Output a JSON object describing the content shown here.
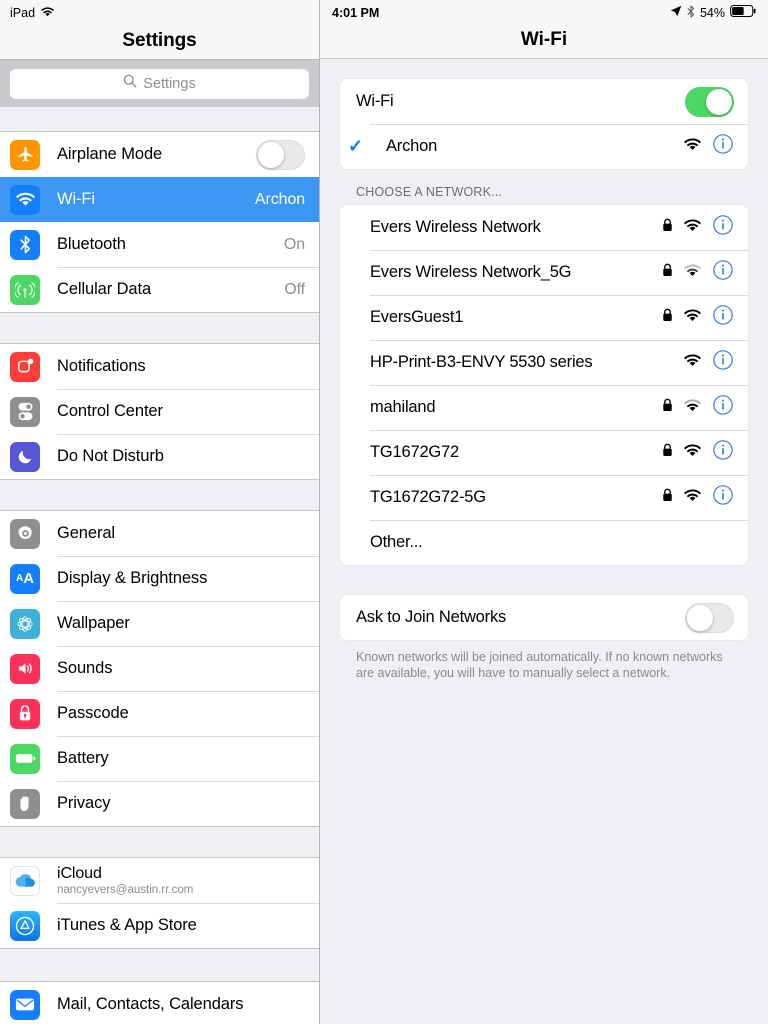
{
  "sidebar": {
    "status": {
      "device": "iPad",
      "wifi_icon": "wifi-icon"
    },
    "title": "Settings",
    "search": {
      "placeholder": "Settings",
      "icon": "search-icon"
    },
    "groups": [
      {
        "items": [
          {
            "label": "Airplane Mode",
            "icon": "airplane-icon",
            "color": "#FF9500",
            "control": "toggle",
            "on": false
          },
          {
            "label": "Wi-Fi",
            "icon": "wifi-icon",
            "color": "#147EFB",
            "value": "Archon",
            "selected": true
          },
          {
            "label": "Bluetooth",
            "icon": "bluetooth-icon",
            "color": "#147EFB",
            "value": "On"
          },
          {
            "label": "Cellular Data",
            "icon": "cellular-icon",
            "color": "#4CD763",
            "value": "Off"
          }
        ]
      },
      {
        "items": [
          {
            "label": "Notifications",
            "icon": "notifications-icon",
            "color": "#FC3D39"
          },
          {
            "label": "Control Center",
            "icon": "control-center-icon",
            "color": "#8E8E93"
          },
          {
            "label": "Do Not Disturb",
            "icon": "moon-icon",
            "color": "#5756D5"
          }
        ]
      },
      {
        "items": [
          {
            "label": "General",
            "icon": "gear-icon",
            "color": "#8E8E93"
          },
          {
            "label": "Display & Brightness",
            "icon": "text-size-icon",
            "color": "#147EFB"
          },
          {
            "label": "Wallpaper",
            "icon": "wallpaper-icon",
            "color": "#3FB0D6"
          },
          {
            "label": "Sounds",
            "icon": "speaker-icon",
            "color": "#FC3158"
          },
          {
            "label": "Passcode",
            "icon": "lock-icon",
            "color": "#FC3158"
          },
          {
            "label": "Battery",
            "icon": "battery-icon",
            "color": "#4CD763"
          },
          {
            "label": "Privacy",
            "icon": "hand-icon",
            "color": "#8E8E93"
          }
        ]
      },
      {
        "items": [
          {
            "label": "iCloud",
            "sublabel": "nancyevers@austin.rr.com",
            "icon": "icloud-icon",
            "color": "#FFFFFF"
          },
          {
            "label": "iTunes & App Store",
            "icon": "app-store-icon",
            "color": "#1B9CF4"
          }
        ]
      },
      {
        "items": [
          {
            "label": "Mail, Contacts, Calendars",
            "icon": "mail-icon",
            "color": "#147EFB"
          }
        ]
      }
    ]
  },
  "panel": {
    "status": {
      "time": "4:01 PM",
      "location_icon": "location-arrow-icon",
      "bluetooth_icon": "bluetooth-icon",
      "battery_percent": "54%",
      "battery_icon": "battery-icon"
    },
    "title": "Wi-Fi",
    "wifi_toggle": {
      "label": "Wi-Fi",
      "on": true
    },
    "connected_network": {
      "name": "Archon",
      "checked": true,
      "signal_icon": "wifi-icon",
      "info_icon": "info-icon"
    },
    "section_header": "CHOOSE A NETWORK...",
    "networks": [
      {
        "name": "Evers Wireless Network",
        "locked": true,
        "signal_icon": "wifi-icon",
        "info_icon": "info-icon"
      },
      {
        "name": "Evers Wireless Network_5G",
        "locked": true,
        "signal_icon": "wifi-icon",
        "info_icon": "info-icon"
      },
      {
        "name": "EversGuest1",
        "locked": true,
        "signal_icon": "wifi-icon",
        "info_icon": "info-icon"
      },
      {
        "name": "HP-Print-B3-ENVY 5530 series",
        "locked": false,
        "signal_icon": "wifi-icon",
        "info_icon": "info-icon"
      },
      {
        "name": "mahiland",
        "locked": true,
        "signal_icon": "wifi-icon",
        "info_icon": "info-icon"
      },
      {
        "name": "TG1672G72",
        "locked": true,
        "signal_icon": "wifi-icon",
        "info_icon": "info-icon"
      },
      {
        "name": "TG1672G72-5G",
        "locked": true,
        "signal_icon": "wifi-icon",
        "info_icon": "info-icon"
      },
      {
        "name": "Other...",
        "locked": false,
        "signal_icon": null,
        "info_icon": null
      }
    ],
    "ask_to_join": {
      "label": "Ask to Join Networks",
      "on": false
    },
    "footnote": "Known networks will be joined automatically. If no known networks are available, you will have to manually select a network."
  },
  "colors": {
    "accent_blue": "#147EFB",
    "selected_row": "#3B97F3",
    "toggle_green": "#4CD763",
    "background": "#EFEFF4"
  }
}
